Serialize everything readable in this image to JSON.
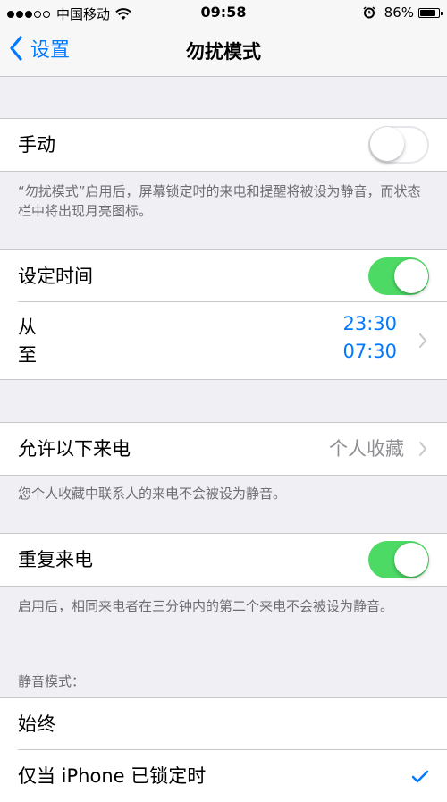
{
  "status_bar": {
    "carrier": "中国移动",
    "time": "09:58",
    "battery": "86%",
    "battery_level": 0.86,
    "signal_bars_filled": 3,
    "signal_bars_total": 5
  },
  "nav": {
    "back_label": "设置",
    "title": "勿扰模式"
  },
  "manual": {
    "label": "手动",
    "enabled": false,
    "footer": "“勿扰模式”启用后，屏幕锁定时的来电和提醒将被设为静音，而状态栏中将出现月亮图标。"
  },
  "scheduled": {
    "label": "设定时间",
    "enabled": true,
    "from_label": "从",
    "to_label": "至",
    "from_time": "23:30",
    "to_time": "07:30"
  },
  "allow_calls": {
    "label": "允许以下来电",
    "value": "个人收藏",
    "footer": "您个人收藏中联系人的来电不会被设为静音。"
  },
  "repeated_calls": {
    "label": "重复来电",
    "enabled": true,
    "footer": "启用后，相同来电者在三分钟内的第二个来电不会被设为静音。"
  },
  "silence": {
    "header": "静音模式：",
    "options": [
      {
        "label": "始终",
        "selected": false
      },
      {
        "label": "仅当 iPhone 已锁定时",
        "selected": true
      }
    ]
  },
  "colors": {
    "accent": "#007aff",
    "toggle_on": "#4cd964",
    "background": "#efeff4",
    "secondary_text": "#6d6d72"
  }
}
